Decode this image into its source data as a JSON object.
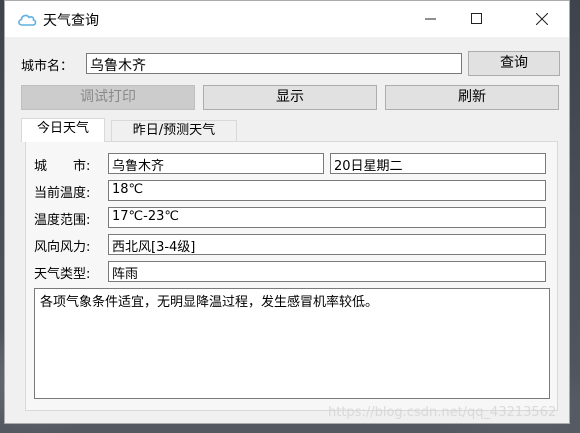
{
  "window": {
    "title": "天气查询",
    "icon": "cloud-icon"
  },
  "search": {
    "city_label": "城市名：",
    "city_value": "乌鲁木齐",
    "query_button": "查询"
  },
  "actions": {
    "debug_print": "调试打印",
    "show": "显示",
    "refresh": "刷新"
  },
  "tabs": [
    {
      "label": "今日天气",
      "active": true
    },
    {
      "label": "昨日/预测天气",
      "active": false
    }
  ],
  "today": {
    "city_label": "城　　市:",
    "city_value": "乌鲁木齐",
    "date_value": "20日星期二",
    "current_temp_label": "当前温度:",
    "current_temp_value": "18℃",
    "temp_range_label": "温度范围:",
    "temp_range_value": "17℃-23℃",
    "wind_label": "风向风力:",
    "wind_value": "西北风[3-4级]",
    "weather_type_label": "天气类型:",
    "weather_type_value": "阵雨",
    "advice": "各项气象条件适宜，无明显降温过程，发生感冒机率较低。"
  },
  "watermark": "https://blog.csdn.net/qq_43213562",
  "colors": {
    "accent": "#5fb0e0",
    "window_bg": "#f0f0f0",
    "disabled_text": "#8a8a8a"
  }
}
